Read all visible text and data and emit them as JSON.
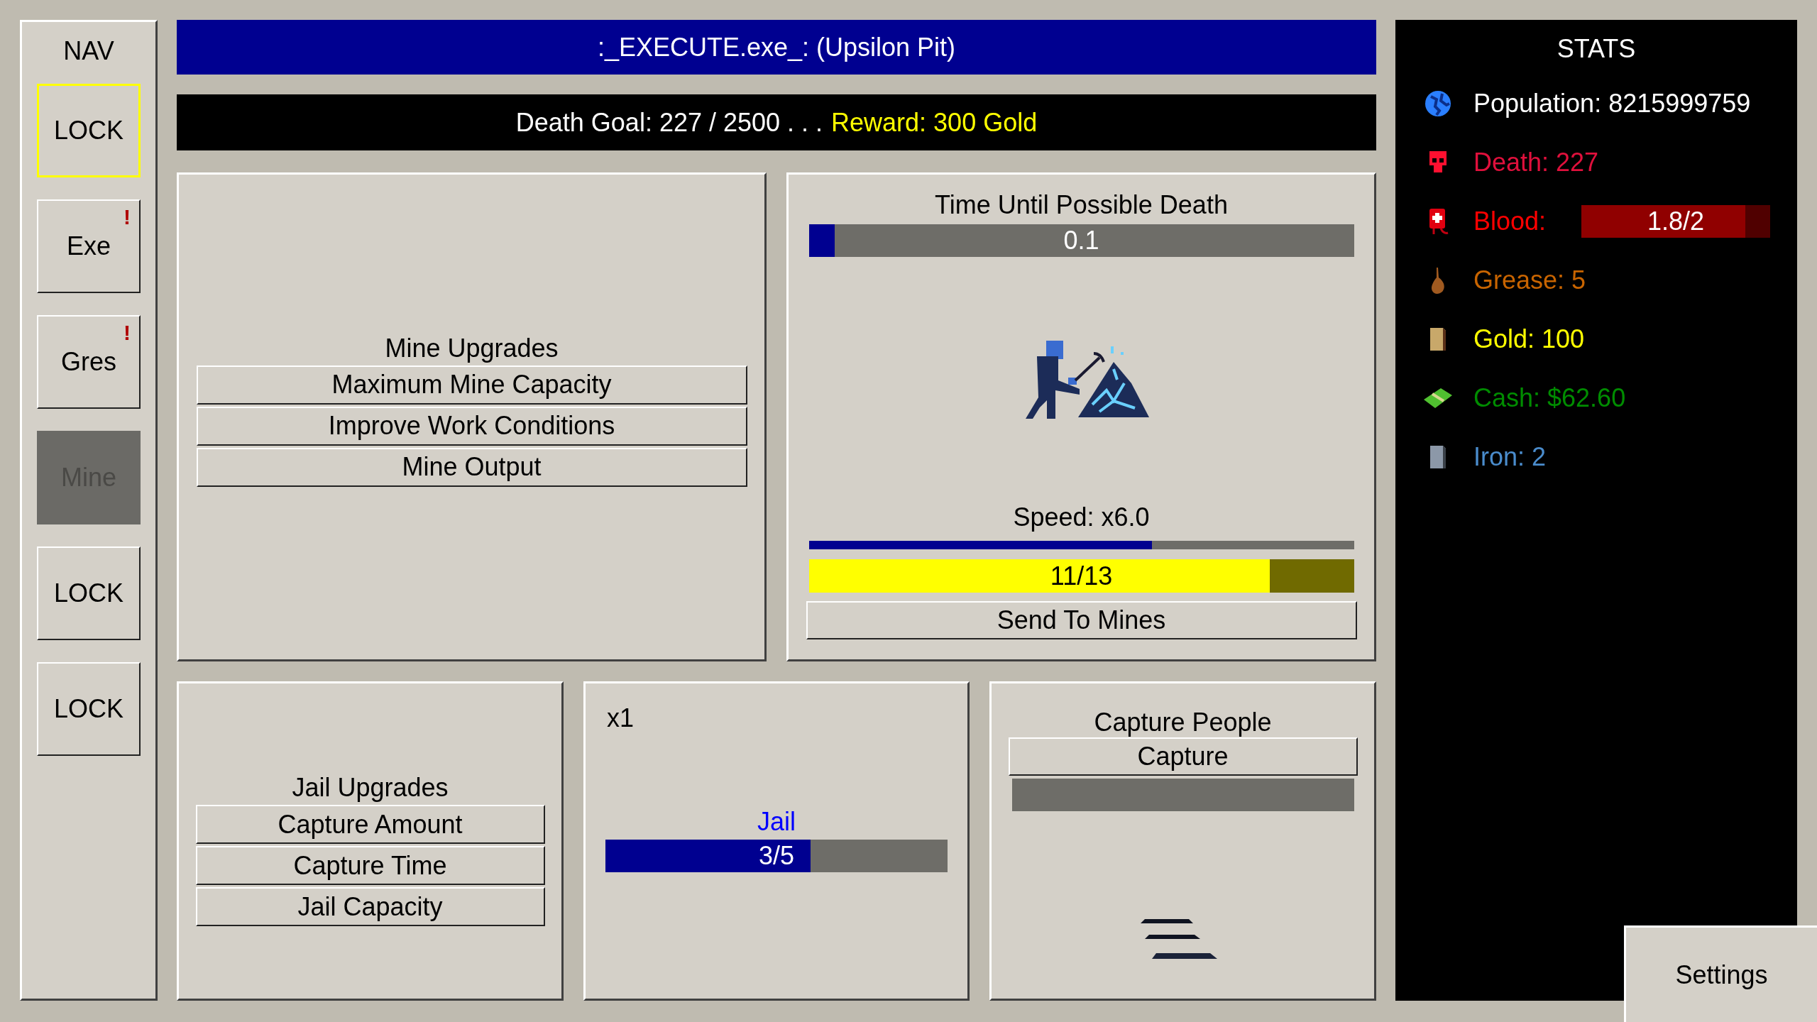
{
  "nav": {
    "title": "NAV",
    "items": [
      {
        "label": "LOCK",
        "highlighted": true,
        "selected": false
      },
      {
        "label": "Exe",
        "highlighted": false,
        "alert": "!",
        "selected": false
      },
      {
        "label": "Gres",
        "highlighted": false,
        "alert": "!",
        "selected": false
      },
      {
        "label": "Mine",
        "highlighted": false,
        "selected": true
      },
      {
        "label": "LOCK",
        "highlighted": false,
        "selected": false
      },
      {
        "label": "LOCK",
        "highlighted": false,
        "selected": false
      }
    ]
  },
  "header": {
    "title": ":_EXECUTE.exe_: (Upsilon Pit)"
  },
  "goal": {
    "progress": "Death Goal: 227 / 2500 . . .",
    "reward": "Reward: 300 Gold"
  },
  "mine_upgrades": {
    "title": "Mine Upgrades",
    "buttons": [
      "Maximum Mine Capacity",
      "Improve Work Conditions",
      "Mine Output"
    ]
  },
  "mine": {
    "timer_title": "Time Until Possible Death",
    "timer": {
      "level": 0.047,
      "reading": "0.1"
    },
    "speed_label": "Speed: x6.0",
    "speed": {
      "level": 0.63
    },
    "workers": {
      "level": 0.846,
      "reading": "11/13"
    },
    "action": "Send To Mines"
  },
  "jail_upgrades": {
    "title": "Jail Upgrades",
    "buttons": [
      "Capture Amount",
      "Capture Time",
      "Jail Capacity"
    ]
  },
  "jail": {
    "multiplier": "x1",
    "title": "Jail",
    "bar": {
      "level": 0.6,
      "reading": "3/5"
    }
  },
  "capture": {
    "title": "Capture People",
    "action": "Capture"
  },
  "stats": {
    "title": "STATS",
    "items": [
      {
        "kind": "text",
        "label": "Population: 8215999759",
        "color": "#ffffff"
      },
      {
        "kind": "text",
        "label": "Death: 227",
        "color": "#e0103c"
      },
      {
        "kind": "bar",
        "label": "Blood:",
        "color": "#ff0000",
        "level": 0.87,
        "reading": "1.8/2"
      },
      {
        "kind": "text",
        "label": "Grease: 5",
        "color": "#c86400"
      },
      {
        "kind": "text",
        "label": "Gold: 100",
        "color": "#ffff00"
      },
      {
        "kind": "text",
        "label": "Cash: $62.60",
        "color": "#008c00"
      },
      {
        "kind": "text",
        "label": "Iron: 2",
        "color": "#4a8ccc"
      }
    ]
  },
  "settings": {
    "label": "Settings"
  }
}
